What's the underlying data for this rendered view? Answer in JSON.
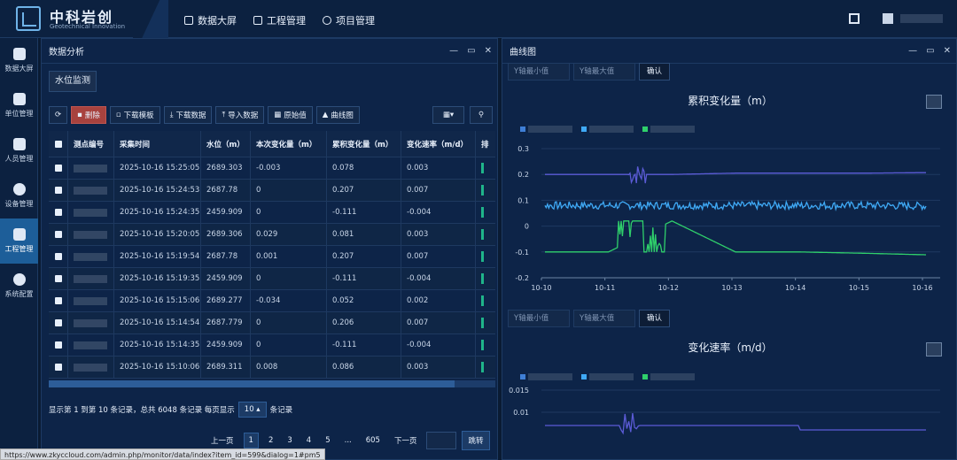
{
  "app": {
    "brand": "中科岩创",
    "brand_sub": "Geotechnical Innovation"
  },
  "topnav": [
    {
      "label": "数据大屏",
      "icon": "cube-icon"
    },
    {
      "label": "工程管理",
      "icon": "chart-icon"
    },
    {
      "label": "项目管理",
      "icon": "circle-icon"
    }
  ],
  "sidebar": {
    "items": [
      {
        "label": "数据大屏",
        "icon": "cube-icon"
      },
      {
        "label": "单位管理",
        "icon": "calendar-check-icon"
      },
      {
        "label": "人员管理",
        "icon": "person-card-icon"
      },
      {
        "label": "设备管理",
        "icon": "gear-icon"
      },
      {
        "label": "工程管理",
        "icon": "chart-icon",
        "active": true
      },
      {
        "label": "系统配置",
        "icon": "more-icon"
      }
    ]
  },
  "left_panel": {
    "title": "数据分析",
    "tab": "水位监测",
    "toolbar": {
      "refresh": "⟳",
      "delete": "删除",
      "download_template": "下载模板",
      "download_data": "下载数据",
      "import_data": "导入数据",
      "raw_values": "原始值",
      "curve_chart": "曲线图",
      "columns": "▦▾",
      "search": "⚲"
    },
    "table": {
      "headers": [
        "测点编号",
        "采集时间",
        "水位（m）",
        "本次变化量（m）",
        "累积变化量（m）",
        "变化速率（m/d）",
        "排"
      ],
      "rows": [
        [
          "2025-10-16 15:25:05",
          "2689.303",
          "-0.003",
          "0.078",
          "0.003"
        ],
        [
          "2025-10-16 15:24:53",
          "2687.78",
          "0",
          "0.207",
          "0.007"
        ],
        [
          "2025-10-16 15:24:35",
          "2459.909",
          "0",
          "-0.111",
          "-0.004"
        ],
        [
          "2025-10-16 15:20:05",
          "2689.306",
          "0.029",
          "0.081",
          "0.003"
        ],
        [
          "2025-10-16 15:19:54",
          "2687.78",
          "0.001",
          "0.207",
          "0.007"
        ],
        [
          "2025-10-16 15:19:35",
          "2459.909",
          "0",
          "-0.111",
          "-0.004"
        ],
        [
          "2025-10-16 15:15:06",
          "2689.277",
          "-0.034",
          "0.052",
          "0.002"
        ],
        [
          "2025-10-16 15:14:54",
          "2687.779",
          "0",
          "0.206",
          "0.007"
        ],
        [
          "2025-10-16 15:14:35",
          "2459.909",
          "0",
          "-0.111",
          "-0.004"
        ],
        [
          "2025-10-16 15:10:06",
          "2689.311",
          "0.008",
          "0.086",
          "0.003"
        ]
      ]
    },
    "pager": {
      "info_prefix": "显示第 1 到第 10 条记录，总共 6048 条记录 每页显示",
      "page_size": "10 ▴",
      "info_suffix": "条记录",
      "prev": "上一页",
      "pages": [
        "1",
        "2",
        "3",
        "4",
        "5",
        "...",
        "605"
      ],
      "next": "下一页",
      "jump": "跳转"
    }
  },
  "right_panel": {
    "title": "曲线图",
    "y_min_placeholder": "Y轴最小值",
    "y_max_placeholder": "Y轴最大值",
    "confirm": "确认"
  },
  "chart_data": [
    {
      "type": "line",
      "title": "累积变化量（m）",
      "x": [
        "10-10",
        "10-11",
        "10-12",
        "10-13",
        "10-14",
        "10-15",
        "10-16"
      ],
      "ylim": [
        -0.2,
        0.3
      ],
      "yticks": [
        "0.3",
        "0.2",
        "0.1",
        "0",
        "-0.1",
        "-0.2"
      ],
      "series": [
        {
          "color": "#5b5bd6",
          "values": [
            0.2,
            0.2,
            0.2,
            0.205,
            0.205,
            0.205,
            0.207
          ]
        },
        {
          "color": "#3fa9f5",
          "values": [
            0.08,
            0.08,
            0.08,
            0.08,
            0.08,
            0.08,
            0.078
          ]
        },
        {
          "color": "#2fd06b",
          "values": [
            -0.1,
            -0.1,
            0.02,
            -0.1,
            -0.1,
            -0.105,
            -0.111
          ]
        }
      ]
    },
    {
      "type": "line",
      "title": "变化速率（m/d）",
      "yticks": [
        "0.015",
        "0.01"
      ],
      "series": [
        {
          "color": "#5b5bd6",
          "values": [
            0.007,
            0.007,
            0.007,
            0.007,
            0.006,
            0.006,
            0.004
          ]
        }
      ]
    }
  ],
  "status_url": "https://www.zkyccloud.com/admin.php/monitor/data/index?item_id=599&dialog=1#pm5"
}
